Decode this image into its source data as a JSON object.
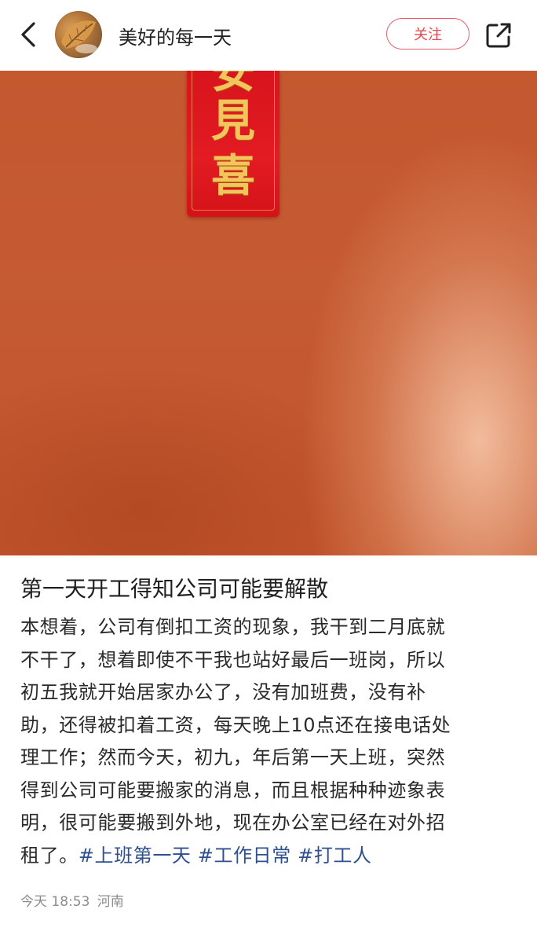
{
  "header": {
    "back_icon": "chevron-left-icon",
    "username": "美好的每一天",
    "follow_label": "关注",
    "share_icon": "share-external-icon",
    "accent_color": "#e8474f"
  },
  "photo": {
    "banner_chars": [
      "安",
      "見",
      "喜"
    ],
    "wall_color": "#c4582f",
    "banner_color": "#e31b22"
  },
  "post": {
    "title": "第一天开工得知公司可能要解散",
    "lines": [
      "本想着，公司有倒扣工资的现象，我干到二月底就",
      "不干了，想着即使不干我也站好最后一班岗，所以",
      "初五我就开始居家办公了，没有加班费，没有补",
      "助，还得被扣着工资，每天晚上10点还在接电话处",
      "理工作；然而今天，初九，年后第一天上班，突然",
      "得到公司可能要搬家的消息，而且根据种种迹象表",
      "明，很可能要搬到外地，现在办公室已经在对外招"
    ],
    "last_line_text": "租了。",
    "tags": [
      "#上班第一天",
      "#工作日常",
      "#打工人"
    ],
    "tag_color": "#2f4f8e"
  },
  "meta": {
    "time": "今天 18:53",
    "location": "河南"
  }
}
